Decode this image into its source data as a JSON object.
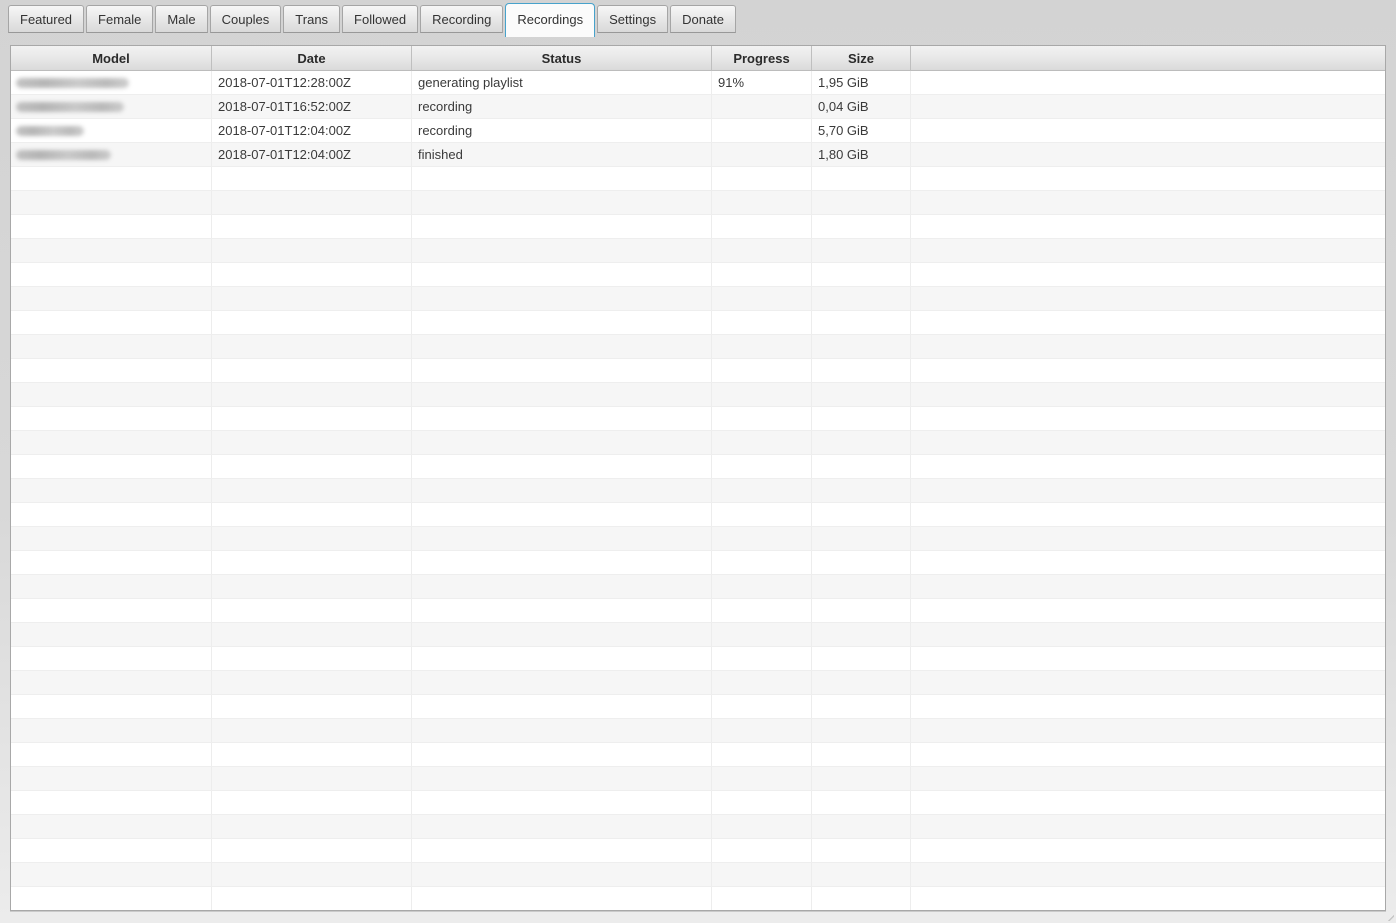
{
  "accent_color": "#47a2cb",
  "tabs": [
    {
      "id": "featured",
      "label": "Featured",
      "active": false
    },
    {
      "id": "female",
      "label": "Female",
      "active": false
    },
    {
      "id": "male",
      "label": "Male",
      "active": false
    },
    {
      "id": "couples",
      "label": "Couples",
      "active": false
    },
    {
      "id": "trans",
      "label": "Trans",
      "active": false
    },
    {
      "id": "followed",
      "label": "Followed",
      "active": false
    },
    {
      "id": "recording",
      "label": "Recording",
      "active": false
    },
    {
      "id": "recordings",
      "label": "Recordings",
      "active": true
    },
    {
      "id": "settings",
      "label": "Settings",
      "active": false
    },
    {
      "id": "donate",
      "label": "Donate",
      "active": false
    }
  ],
  "table": {
    "columns": [
      {
        "id": "model",
        "label": "Model"
      },
      {
        "id": "date",
        "label": "Date"
      },
      {
        "id": "status",
        "label": "Status"
      },
      {
        "id": "progress",
        "label": "Progress"
      },
      {
        "id": "size",
        "label": "Size"
      },
      {
        "id": "filler",
        "label": ""
      }
    ],
    "rows": [
      {
        "model_redacted": true,
        "model_blur_width": 113,
        "date": "2018-07-01T12:28:00Z",
        "status": "generating playlist",
        "progress": "91%",
        "size": "1,95 GiB"
      },
      {
        "model_redacted": true,
        "model_blur_width": 108,
        "date": "2018-07-01T16:52:00Z",
        "status": "recording",
        "progress": "",
        "size": "0,04 GiB"
      },
      {
        "model_redacted": true,
        "model_blur_width": 68,
        "date": "2018-07-01T12:04:00Z",
        "status": "recording",
        "progress": "",
        "size": "5,70 GiB"
      },
      {
        "model_redacted": true,
        "model_blur_width": 95,
        "date": "2018-07-01T12:04:00Z",
        "status": "finished",
        "progress": "",
        "size": "1,80 GiB"
      }
    ],
    "empty_row_count": 31
  }
}
